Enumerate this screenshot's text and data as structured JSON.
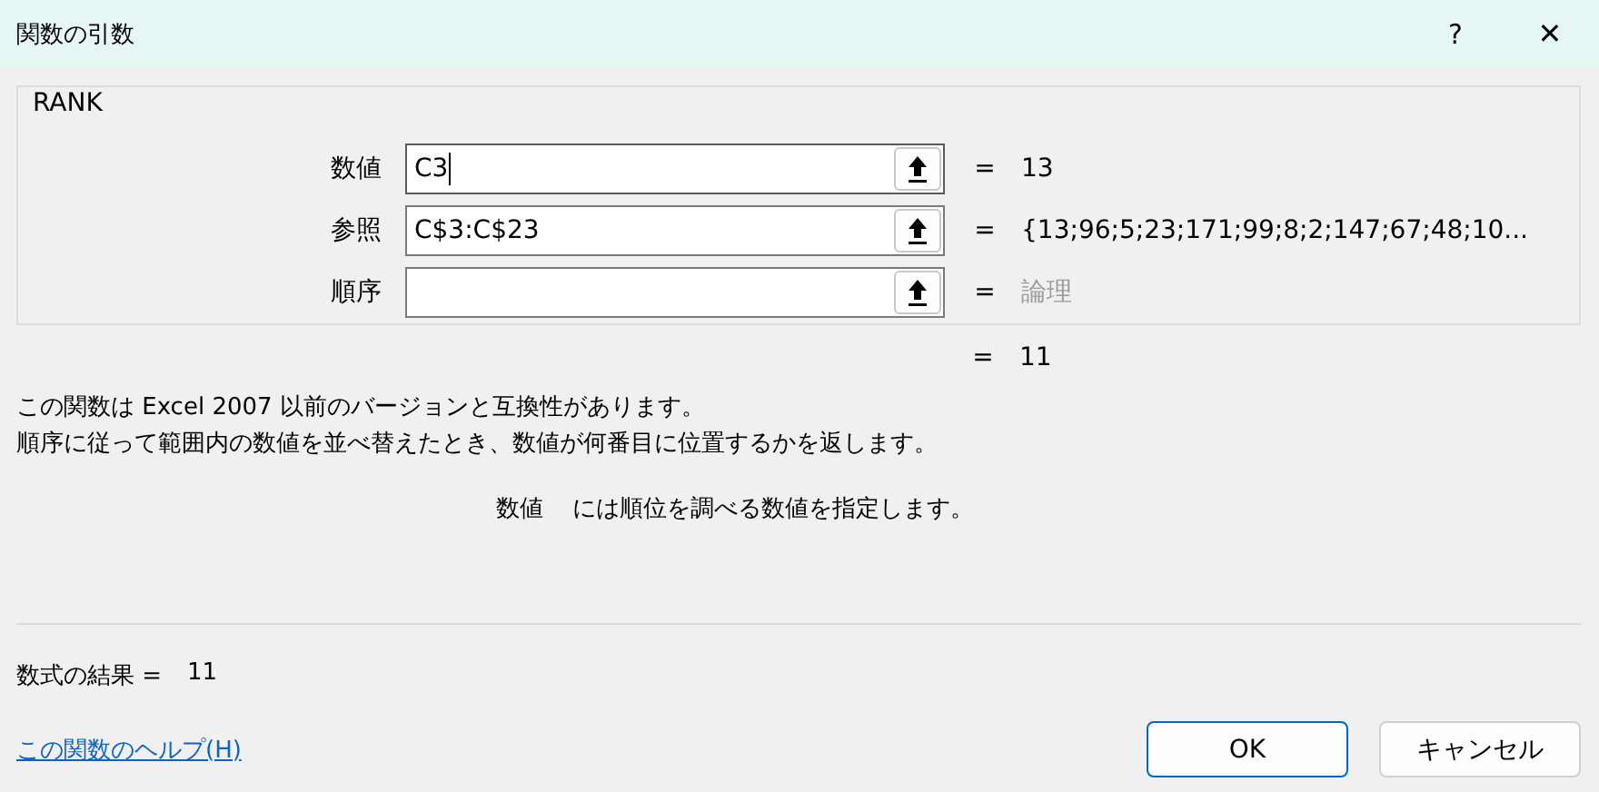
{
  "window": {
    "title": "関数の引数",
    "help": "?",
    "close": "✕"
  },
  "function_name": "RANK",
  "arguments": [
    {
      "label": "数値",
      "value": "C3",
      "focused": true,
      "equals": "=",
      "result": "13",
      "result_dim": false
    },
    {
      "label": "参照",
      "value": "C$3:C$23",
      "focused": false,
      "equals": "=",
      "result": "{13;96;5;23;171;99;8;2;147;67;48;10...",
      "result_dim": false
    },
    {
      "label": "順序",
      "focused": false,
      "equals": "=",
      "result": "論理",
      "result_dim": true
    }
  ],
  "function_result": {
    "equals": "=",
    "value": "11"
  },
  "description": [
    "この関数は Excel 2007 以前のバージョンと互換性があります。",
    "順序に従って範囲内の数値を並べ替えたとき、数値が何番目に位置するかを返します。"
  ],
  "argument_help": {
    "name": "数値",
    "text": "には順位を調べる数値を指定します。"
  },
  "formula_result": {
    "label": "数式の結果 =",
    "value": "11"
  },
  "help_link": "この関数のヘルプ(H)",
  "buttons": [
    {
      "label": "OK",
      "selected": true
    },
    {
      "label": "キャンセル",
      "selected": false
    }
  ]
}
